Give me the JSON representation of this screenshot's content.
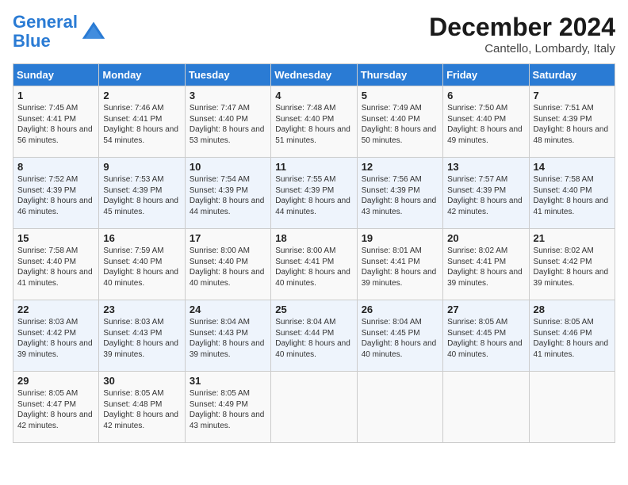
{
  "header": {
    "logo_line1": "General",
    "logo_line2": "Blue",
    "month": "December 2024",
    "location": "Cantello, Lombardy, Italy"
  },
  "weekdays": [
    "Sunday",
    "Monday",
    "Tuesday",
    "Wednesday",
    "Thursday",
    "Friday",
    "Saturday"
  ],
  "weeks": [
    [
      {
        "day": "1",
        "sunrise": "7:45 AM",
        "sunset": "4:41 PM",
        "daylight": "8 hours and 56 minutes."
      },
      {
        "day": "2",
        "sunrise": "7:46 AM",
        "sunset": "4:41 PM",
        "daylight": "8 hours and 54 minutes."
      },
      {
        "day": "3",
        "sunrise": "7:47 AM",
        "sunset": "4:40 PM",
        "daylight": "8 hours and 53 minutes."
      },
      {
        "day": "4",
        "sunrise": "7:48 AM",
        "sunset": "4:40 PM",
        "daylight": "8 hours and 51 minutes."
      },
      {
        "day": "5",
        "sunrise": "7:49 AM",
        "sunset": "4:40 PM",
        "daylight": "8 hours and 50 minutes."
      },
      {
        "day": "6",
        "sunrise": "7:50 AM",
        "sunset": "4:40 PM",
        "daylight": "8 hours and 49 minutes."
      },
      {
        "day": "7",
        "sunrise": "7:51 AM",
        "sunset": "4:39 PM",
        "daylight": "8 hours and 48 minutes."
      }
    ],
    [
      {
        "day": "8",
        "sunrise": "7:52 AM",
        "sunset": "4:39 PM",
        "daylight": "8 hours and 46 minutes."
      },
      {
        "day": "9",
        "sunrise": "7:53 AM",
        "sunset": "4:39 PM",
        "daylight": "8 hours and 45 minutes."
      },
      {
        "day": "10",
        "sunrise": "7:54 AM",
        "sunset": "4:39 PM",
        "daylight": "8 hours and 44 minutes."
      },
      {
        "day": "11",
        "sunrise": "7:55 AM",
        "sunset": "4:39 PM",
        "daylight": "8 hours and 44 minutes."
      },
      {
        "day": "12",
        "sunrise": "7:56 AM",
        "sunset": "4:39 PM",
        "daylight": "8 hours and 43 minutes."
      },
      {
        "day": "13",
        "sunrise": "7:57 AM",
        "sunset": "4:39 PM",
        "daylight": "8 hours and 42 minutes."
      },
      {
        "day": "14",
        "sunrise": "7:58 AM",
        "sunset": "4:40 PM",
        "daylight": "8 hours and 41 minutes."
      }
    ],
    [
      {
        "day": "15",
        "sunrise": "7:58 AM",
        "sunset": "4:40 PM",
        "daylight": "8 hours and 41 minutes."
      },
      {
        "day": "16",
        "sunrise": "7:59 AM",
        "sunset": "4:40 PM",
        "daylight": "8 hours and 40 minutes."
      },
      {
        "day": "17",
        "sunrise": "8:00 AM",
        "sunset": "4:40 PM",
        "daylight": "8 hours and 40 minutes."
      },
      {
        "day": "18",
        "sunrise": "8:00 AM",
        "sunset": "4:41 PM",
        "daylight": "8 hours and 40 minutes."
      },
      {
        "day": "19",
        "sunrise": "8:01 AM",
        "sunset": "4:41 PM",
        "daylight": "8 hours and 39 minutes."
      },
      {
        "day": "20",
        "sunrise": "8:02 AM",
        "sunset": "4:41 PM",
        "daylight": "8 hours and 39 minutes."
      },
      {
        "day": "21",
        "sunrise": "8:02 AM",
        "sunset": "4:42 PM",
        "daylight": "8 hours and 39 minutes."
      }
    ],
    [
      {
        "day": "22",
        "sunrise": "8:03 AM",
        "sunset": "4:42 PM",
        "daylight": "8 hours and 39 minutes."
      },
      {
        "day": "23",
        "sunrise": "8:03 AM",
        "sunset": "4:43 PM",
        "daylight": "8 hours and 39 minutes."
      },
      {
        "day": "24",
        "sunrise": "8:04 AM",
        "sunset": "4:43 PM",
        "daylight": "8 hours and 39 minutes."
      },
      {
        "day": "25",
        "sunrise": "8:04 AM",
        "sunset": "4:44 PM",
        "daylight": "8 hours and 40 minutes."
      },
      {
        "day": "26",
        "sunrise": "8:04 AM",
        "sunset": "4:45 PM",
        "daylight": "8 hours and 40 minutes."
      },
      {
        "day": "27",
        "sunrise": "8:05 AM",
        "sunset": "4:45 PM",
        "daylight": "8 hours and 40 minutes."
      },
      {
        "day": "28",
        "sunrise": "8:05 AM",
        "sunset": "4:46 PM",
        "daylight": "8 hours and 41 minutes."
      }
    ],
    [
      {
        "day": "29",
        "sunrise": "8:05 AM",
        "sunset": "4:47 PM",
        "daylight": "8 hours and 42 minutes."
      },
      {
        "day": "30",
        "sunrise": "8:05 AM",
        "sunset": "4:48 PM",
        "daylight": "8 hours and 42 minutes."
      },
      {
        "day": "31",
        "sunrise": "8:05 AM",
        "sunset": "4:49 PM",
        "daylight": "8 hours and 43 minutes."
      },
      null,
      null,
      null,
      null
    ]
  ]
}
